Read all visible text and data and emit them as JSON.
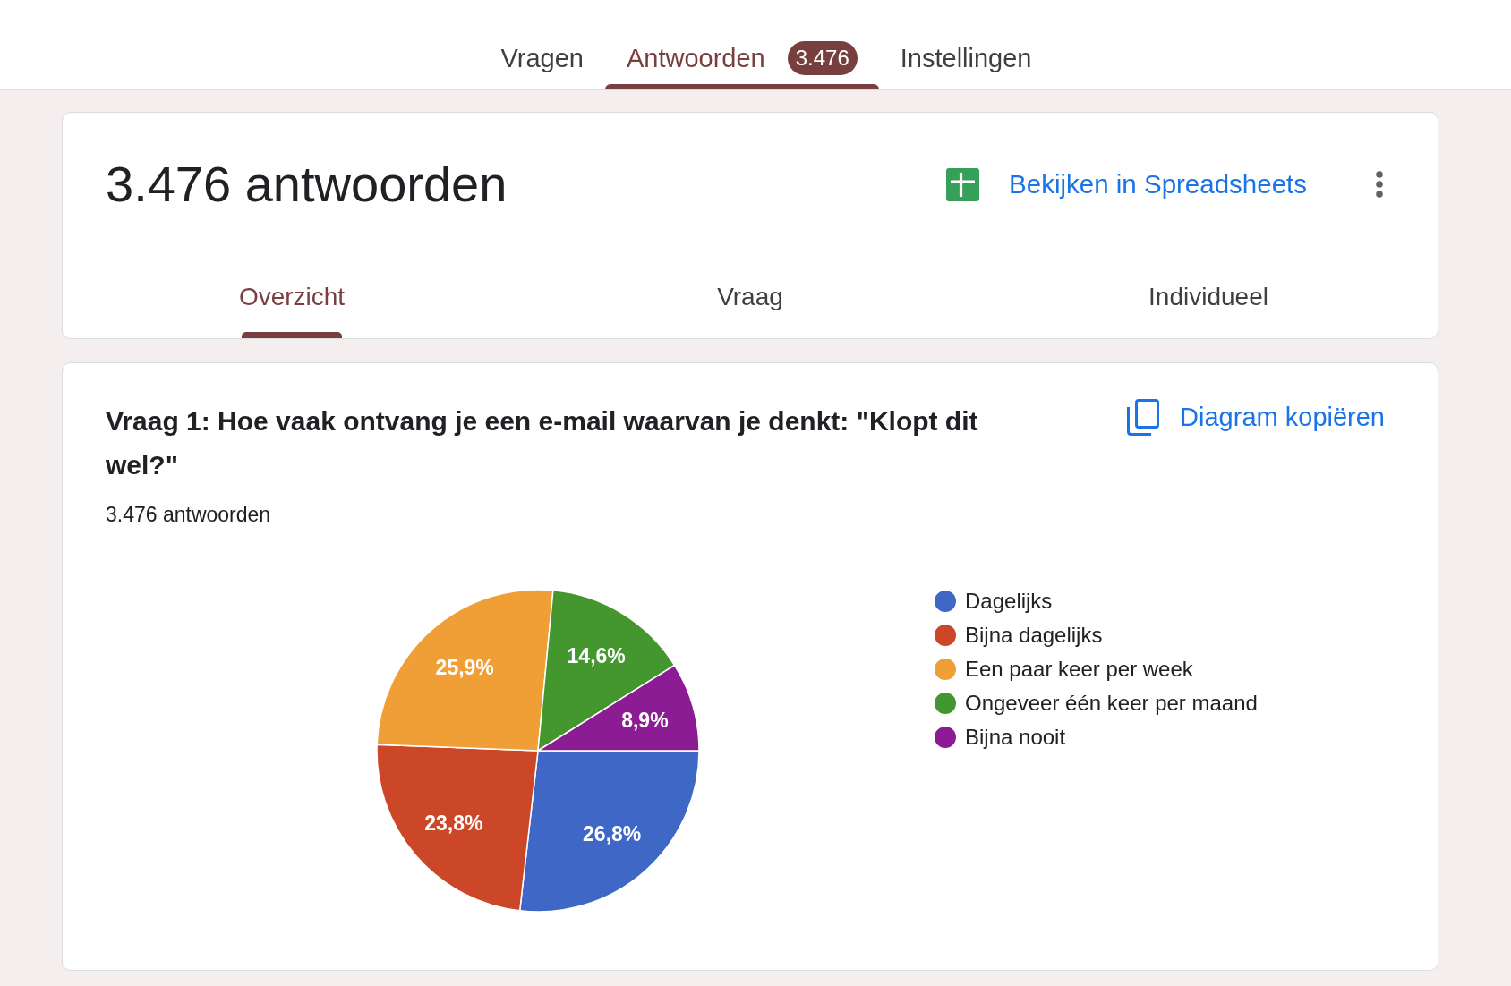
{
  "top_tabs": [
    {
      "label": "Vragen",
      "selected": false
    },
    {
      "label": "Antwoorden",
      "selected": true,
      "badge": "3.476"
    },
    {
      "label": "Instellingen",
      "selected": false
    }
  ],
  "summary": {
    "title": "3.476 antwoorden",
    "sheets_link": "Bekijken in Spreadsheets",
    "view_tabs": [
      {
        "label": "Overzicht",
        "selected": true
      },
      {
        "label": "Vraag",
        "selected": false
      },
      {
        "label": "Individueel",
        "selected": false
      }
    ]
  },
  "question": {
    "title": "Vraag 1: Hoe vaak ontvang je een e-mail waarvan je denkt: \"Klopt dit wel?\"",
    "response_count": "3.476 antwoorden",
    "copy_button": "Diagram kopiëren",
    "chart_data": {
      "type": "pie",
      "categories": [
        "Dagelijks",
        "Bijna dagelijks",
        "Een paar keer per week",
        "Ongeveer één keer per maand",
        "Bijna nooit"
      ],
      "values": [
        26.8,
        23.8,
        25.9,
        14.6,
        8.9
      ],
      "colors": [
        "#3f67c6",
        "#cc4727",
        "#f09f37",
        "#44962f",
        "#8b1c93"
      ],
      "value_labels": [
        "26,8%",
        "23,8%",
        "25,9%",
        "14,6%",
        "8,9%"
      ],
      "legend": "right"
    }
  }
}
